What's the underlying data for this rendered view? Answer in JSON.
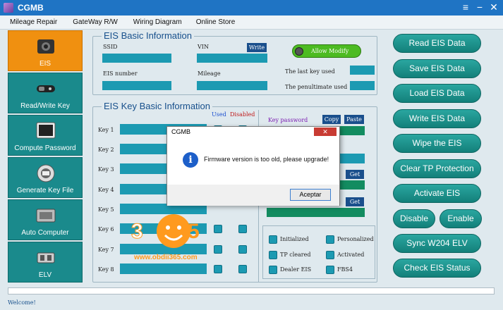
{
  "app": {
    "title": "CGMB"
  },
  "menu": [
    "Mileage Repair",
    "GateWay R/W",
    "Wiring Diagram",
    "Online Store"
  ],
  "sidebar": [
    {
      "label": "EIS",
      "icon": "eis-module-icon"
    },
    {
      "label": "Read/Write Key",
      "icon": "car-key-icon"
    },
    {
      "label": "Compute Password",
      "icon": "computer-screen-icon"
    },
    {
      "label": "Generate Key File",
      "icon": "key-file-icon"
    },
    {
      "label": "Auto Computer",
      "icon": "ecu-module-icon"
    },
    {
      "label": "ELV",
      "icon": "elv-module-icon"
    }
  ],
  "eis_basic": {
    "title": "EIS Basic Information",
    "ssid": "SSID",
    "vin": "VIN",
    "write": "Write",
    "eis_number": "EIS number",
    "mileage": "Mileage",
    "allow_modify": "Allow Modify",
    "last_key": "The last key used",
    "penultimate": "The penultimate used"
  },
  "eis_key": {
    "title": "EIS Key Basic Information",
    "used": "Used",
    "disabled": "Disabled",
    "key_password": "Key password",
    "copy": "Copy",
    "paste": "Paste",
    "get": "Get",
    "keys": [
      "Key 1",
      "Key 2",
      "Key 3",
      "Key 4",
      "Key 5",
      "Key 6",
      "Key 7",
      "Key 8"
    ],
    "status": [
      "Initialized",
      "Personalized",
      "TP cleared",
      "Activated",
      "Dealer EIS",
      "FBS4"
    ]
  },
  "buttons": {
    "read": "Read  EIS Data",
    "save": "Save EIS Data",
    "load": "Load EIS Data",
    "write": "Write EIS Data",
    "wipe": "Wipe the EIS",
    "clear_tp": "Clear TP Protection",
    "activate": "Activate EIS",
    "disable": "Disable",
    "enable": "Enable",
    "sync": "Sync W204 ELV",
    "check": "Check EIS Status"
  },
  "dialog": {
    "title": "CGMB",
    "close": "✕",
    "message": "Firmware version is too old, please upgrade!",
    "ok": "Aceptar"
  },
  "watermark": {
    "digits": [
      "3",
      "5"
    ],
    "url": "www.obdii365.com"
  },
  "statusbar": "Welcome!"
}
